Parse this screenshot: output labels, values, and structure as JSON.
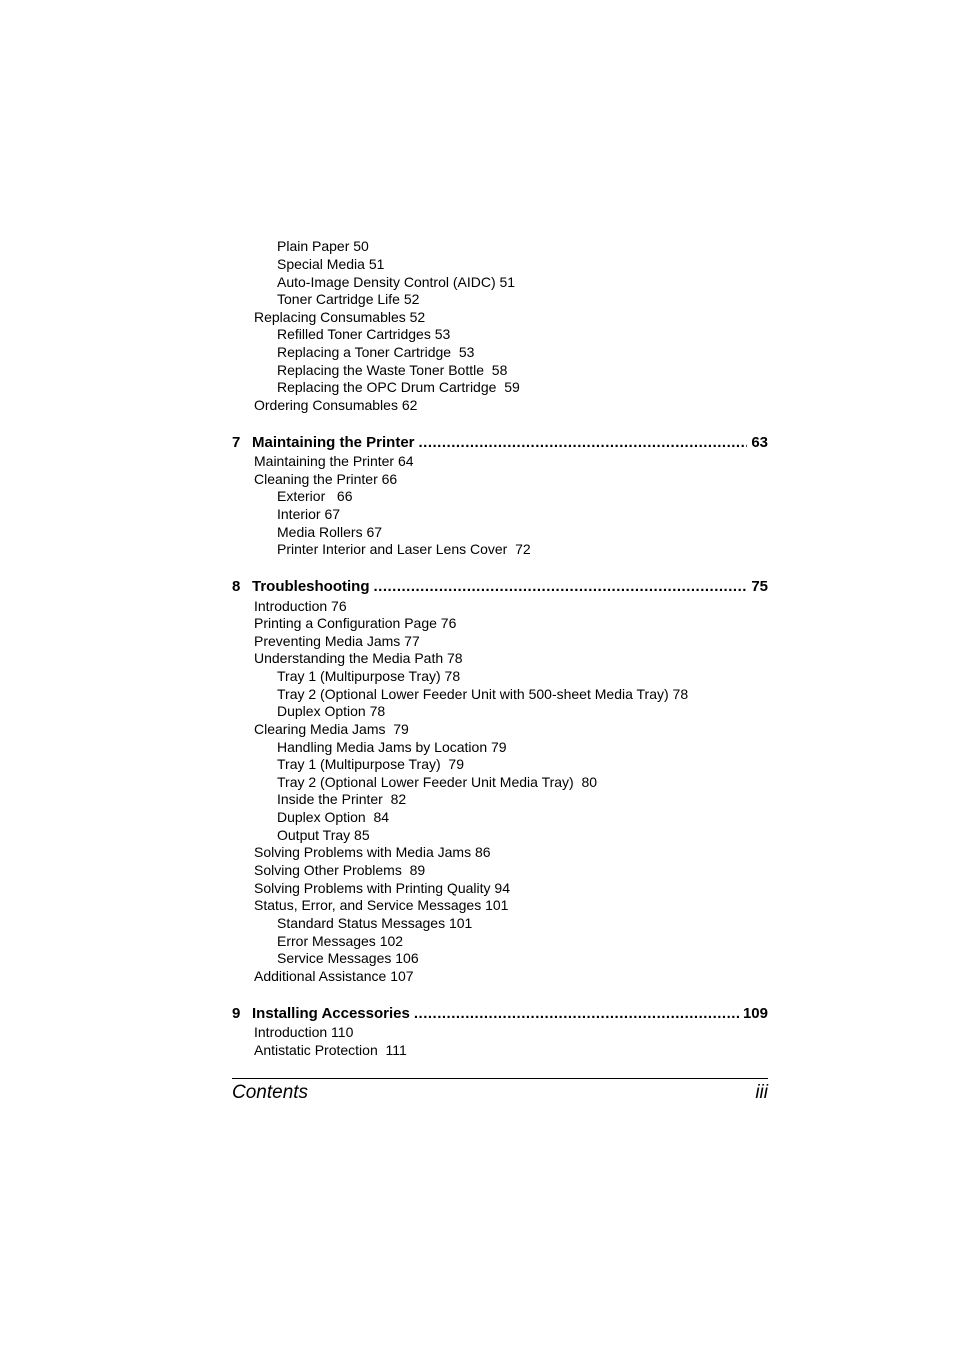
{
  "toc": {
    "lines_top": [
      {
        "level": 2,
        "text": "Plain Paper 50"
      },
      {
        "level": 2,
        "text": "Special Media 51"
      },
      {
        "level": 2,
        "text": "Auto-Image Density Control (AIDC) 51"
      },
      {
        "level": 2,
        "text": "Toner Cartridge Life 52"
      },
      {
        "level": 1,
        "text": "Replacing Consumables 52"
      },
      {
        "level": 2,
        "text": "Refilled Toner Cartridges 53"
      },
      {
        "level": 2,
        "text": "Replacing a Toner Cartridge  53"
      },
      {
        "level": 2,
        "text": "Replacing the Waste Toner Bottle  58"
      },
      {
        "level": 2,
        "text": "Replacing the OPC Drum Cartridge  59"
      },
      {
        "level": 1,
        "text": "Ordering Consumables 62"
      }
    ],
    "chapters": [
      {
        "number": "7",
        "title": "Maintaining the Printer",
        "page": "63",
        "entries": [
          {
            "level": 1,
            "text": "Maintaining the Printer 64"
          },
          {
            "level": 1,
            "text": "Cleaning the Printer 66"
          },
          {
            "level": 2,
            "text": "Exterior   66"
          },
          {
            "level": 2,
            "text": "Interior 67"
          },
          {
            "level": 2,
            "text": "Media Rollers 67"
          },
          {
            "level": 2,
            "text": "Printer Interior and Laser Lens Cover  72"
          }
        ]
      },
      {
        "number": "8",
        "title": "Troubleshooting",
        "page": "75",
        "entries": [
          {
            "level": 1,
            "text": "Introduction 76"
          },
          {
            "level": 1,
            "text": "Printing a Configuration Page 76"
          },
          {
            "level": 1,
            "text": "Preventing Media Jams 77"
          },
          {
            "level": 1,
            "text": "Understanding the Media Path 78"
          },
          {
            "level": 2,
            "text": "Tray 1 (Multipurpose Tray) 78"
          },
          {
            "level": 2,
            "text": "Tray 2 (Optional Lower Feeder Unit with 500-sheet Media Tray) 78"
          },
          {
            "level": 2,
            "text": "Duplex Option 78"
          },
          {
            "level": 1,
            "text": "Clearing Media Jams  79"
          },
          {
            "level": 2,
            "text": "Handling Media Jams by Location 79"
          },
          {
            "level": 2,
            "text": "Tray 1 (Multipurpose Tray)  79"
          },
          {
            "level": 2,
            "text": "Tray 2 (Optional Lower Feeder Unit Media Tray)  80"
          },
          {
            "level": 2,
            "text": "Inside the Printer  82"
          },
          {
            "level": 2,
            "text": "Duplex Option  84"
          },
          {
            "level": 2,
            "text": "Output Tray 85"
          },
          {
            "level": 1,
            "text": "Solving Problems with Media Jams 86"
          },
          {
            "level": 1,
            "text": "Solving Other Problems  89"
          },
          {
            "level": 1,
            "text": "Solving Problems with Printing Quality 94"
          },
          {
            "level": 1,
            "text": "Status, Error, and Service Messages 101"
          },
          {
            "level": 2,
            "text": "Standard Status Messages 101"
          },
          {
            "level": 2,
            "text": "Error Messages 102"
          },
          {
            "level": 2,
            "text": "Service Messages 106"
          },
          {
            "level": 1,
            "text": "Additional Assistance 107"
          }
        ]
      },
      {
        "number": "9",
        "title": "Installing Accessories",
        "page": "109",
        "entries": [
          {
            "level": 1,
            "text": "Introduction 110"
          },
          {
            "level": 1,
            "text": "Antistatic Protection  111"
          }
        ]
      }
    ]
  },
  "footer": {
    "title": "Contents",
    "page": "iii"
  }
}
